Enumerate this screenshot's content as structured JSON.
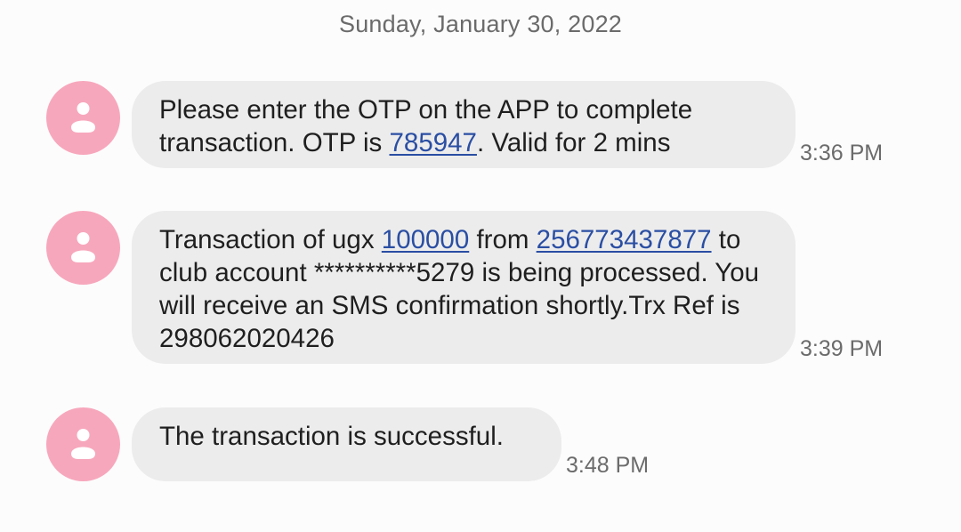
{
  "date_header": "Sunday, January 30, 2022",
  "messages": [
    {
      "text_before_otp": "Please enter the OTP on the APP to complete transaction. OTP is ",
      "otp": "785947",
      "text_after_otp": ". Valid for 2 mins",
      "time": "3:36 PM"
    },
    {
      "text_part1": "Transaction of ugx ",
      "amount": "100000",
      "text_part2": " from ",
      "phone": "256773437877",
      "text_part3": " to club account **********5279 is being processed. You will receive an SMS confirmation shortly.Trx Ref is 298062020426",
      "time": "3:39 PM"
    },
    {
      "text": "The transaction is successful.",
      "time": "3:48 PM"
    }
  ],
  "avatar_icon": "person-icon",
  "colors": {
    "avatar_bg": "#f7a7bc",
    "bubble_bg": "#ececec",
    "link": "#2a4ea3",
    "timestamp": "#6b6b6b"
  }
}
